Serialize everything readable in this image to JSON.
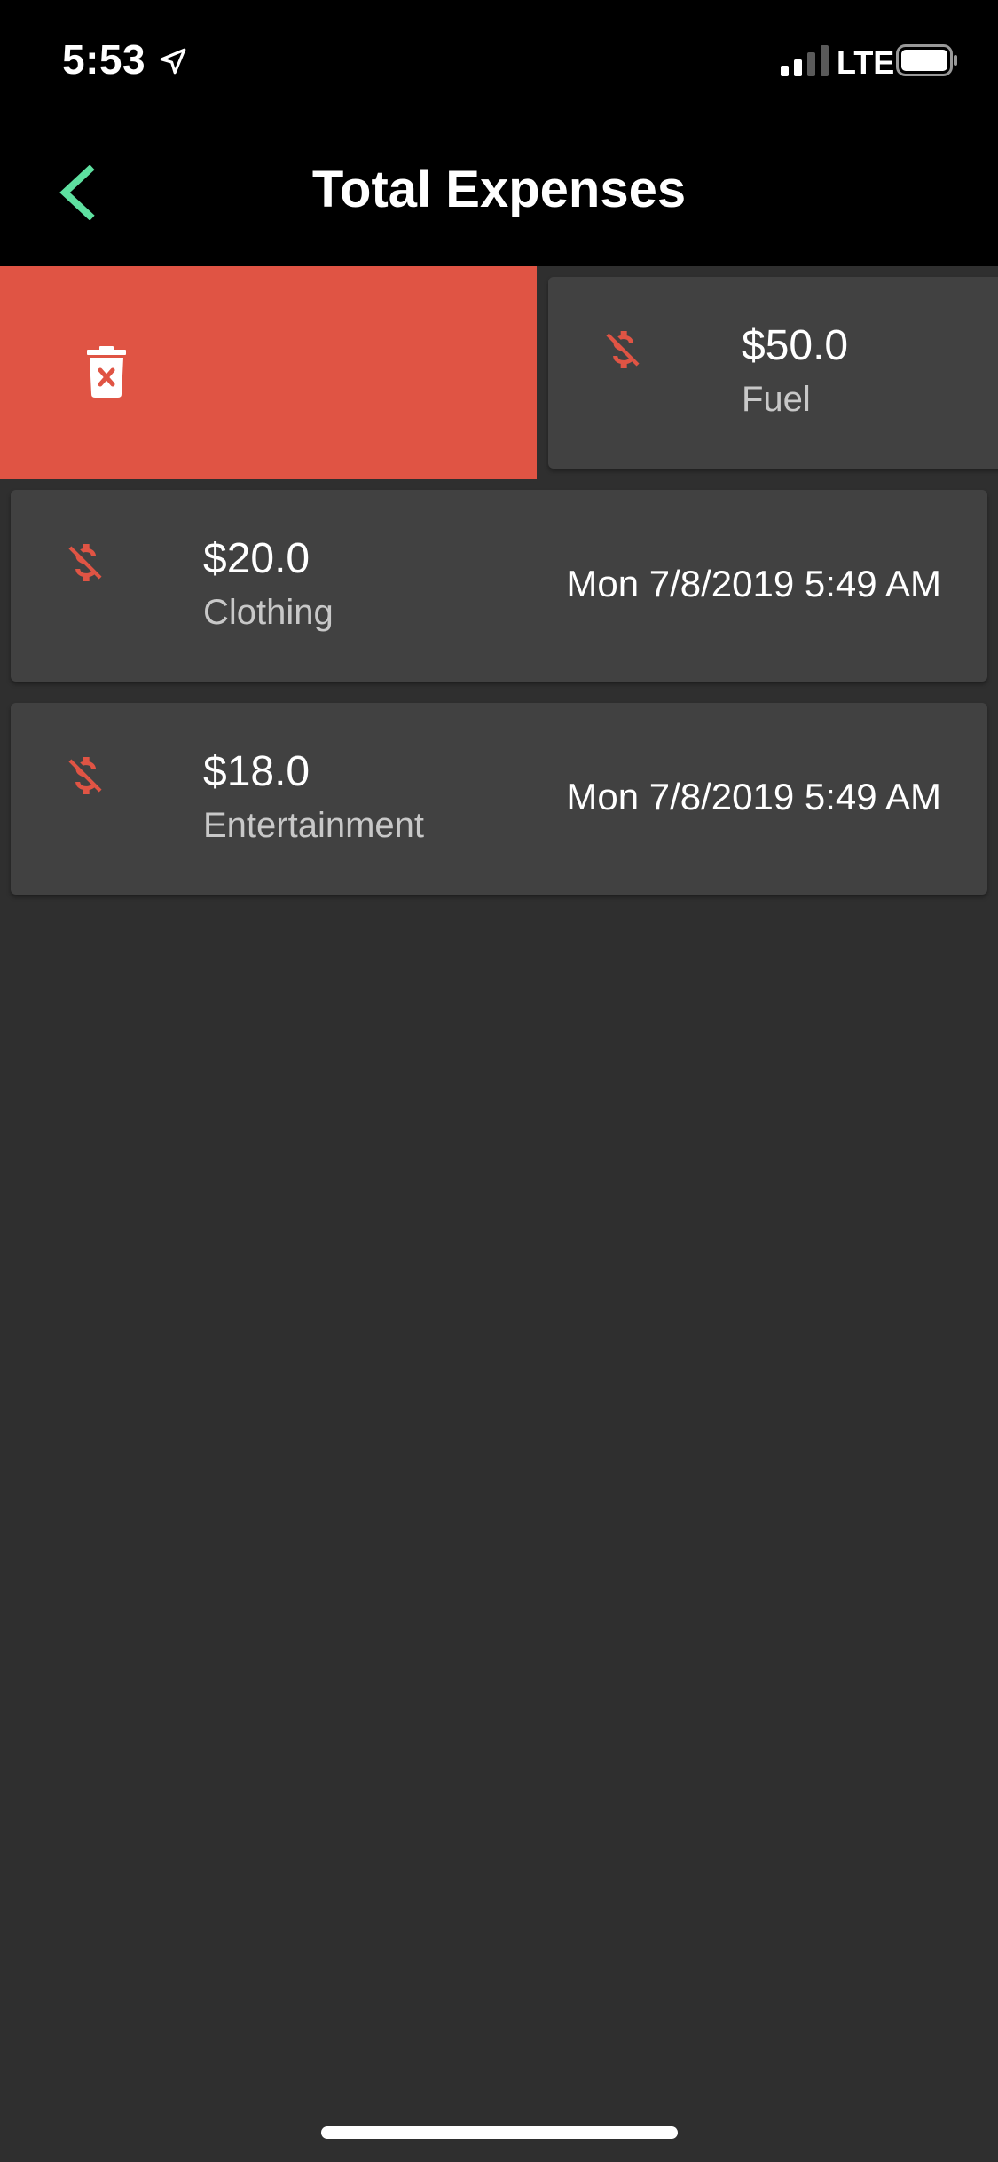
{
  "status_bar": {
    "time": "5:53",
    "network": "LTE",
    "location_icon": "location-arrow-icon",
    "signal_icon": "cellular-signal-icon",
    "battery_icon": "battery-icon"
  },
  "nav": {
    "title": "Total Expenses",
    "back_icon": "chevron-left-icon",
    "accent_color": "#5ee0a0"
  },
  "delete_action": {
    "icon": "trash-delete-icon",
    "color": "#e05444"
  },
  "expenses": [
    {
      "amount": "$50.0",
      "category": "Fuel",
      "date": "",
      "icon": "money-off-icon"
    },
    {
      "amount": "$20.0",
      "category": "Clothing",
      "date": "Mon 7/8/2019 5:49 AM",
      "icon": "money-off-icon"
    },
    {
      "amount": "$18.0",
      "category": "Entertainment",
      "date": "Mon 7/8/2019 5:49 AM",
      "icon": "money-off-icon"
    }
  ],
  "colors": {
    "background": "#2f2f2f",
    "card": "#414141",
    "icon_red": "#e05444",
    "bar": "#000000"
  }
}
